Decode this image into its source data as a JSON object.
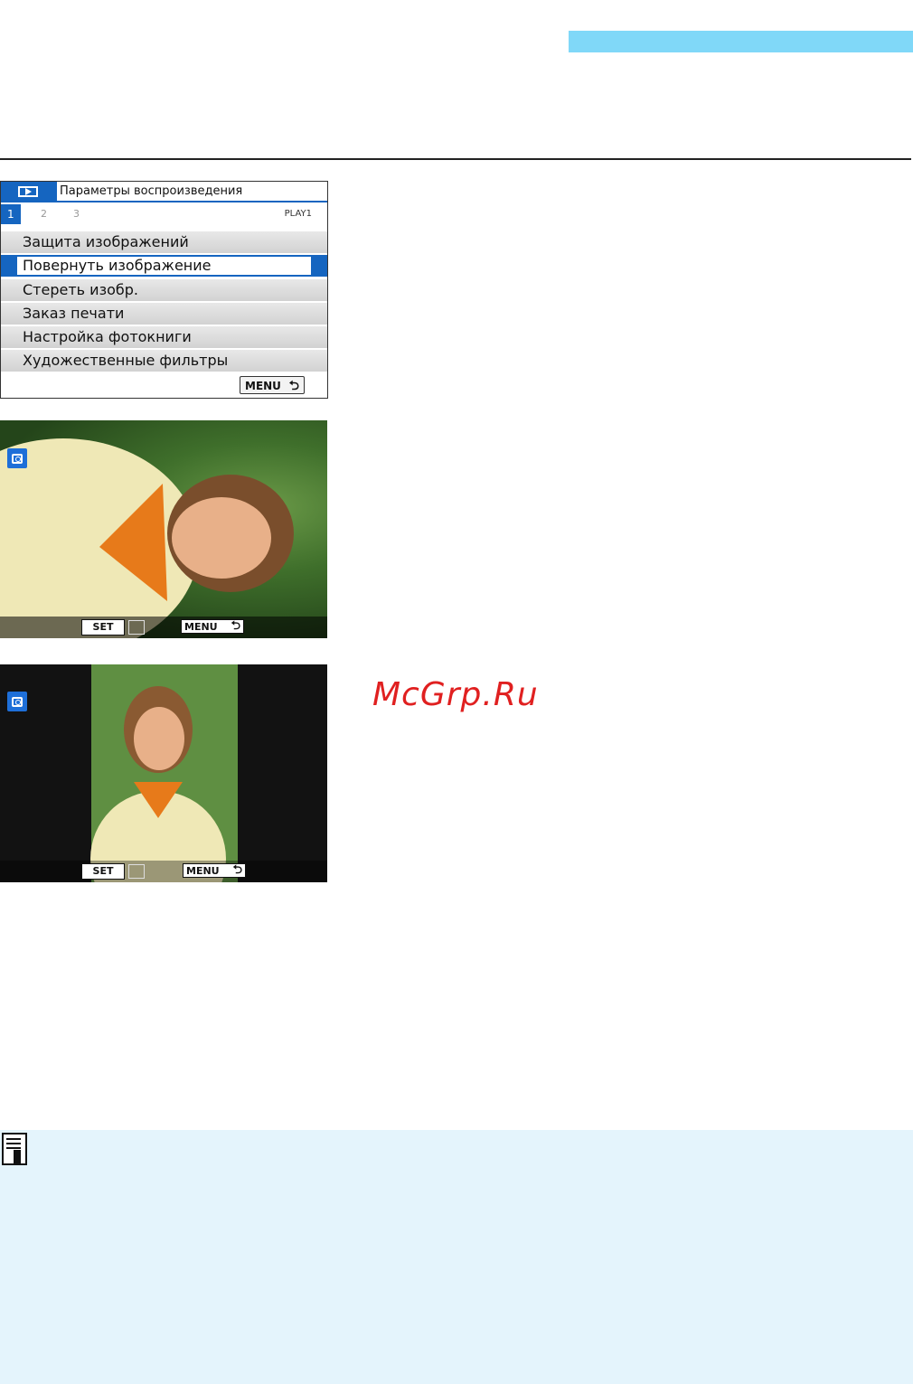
{
  "menu": {
    "header_title": "Параметры воспроизведения",
    "tab_numbers": [
      "1",
      "2",
      "3"
    ],
    "tab_label": "PLAY1",
    "items": [
      "Защита изображений",
      "Повернуть изображение",
      "Стереть изобр.",
      "Заказ печати",
      "Настройка фотокниги",
      "Художественные фильтры"
    ],
    "selected_index": 1,
    "menu_button": "MENU"
  },
  "screens": {
    "set_label": "SET",
    "menu_label": "MENU"
  },
  "watermark": "McGrp.Ru",
  "colors": {
    "accent_bar": "#80d8f8",
    "menu_blue": "#1565c0",
    "note_bg": "#e4f4fc",
    "watermark": "#e02020"
  },
  "icons": [
    "play-icon",
    "rotate-icon",
    "return-arrow-icon",
    "memo-icon"
  ]
}
